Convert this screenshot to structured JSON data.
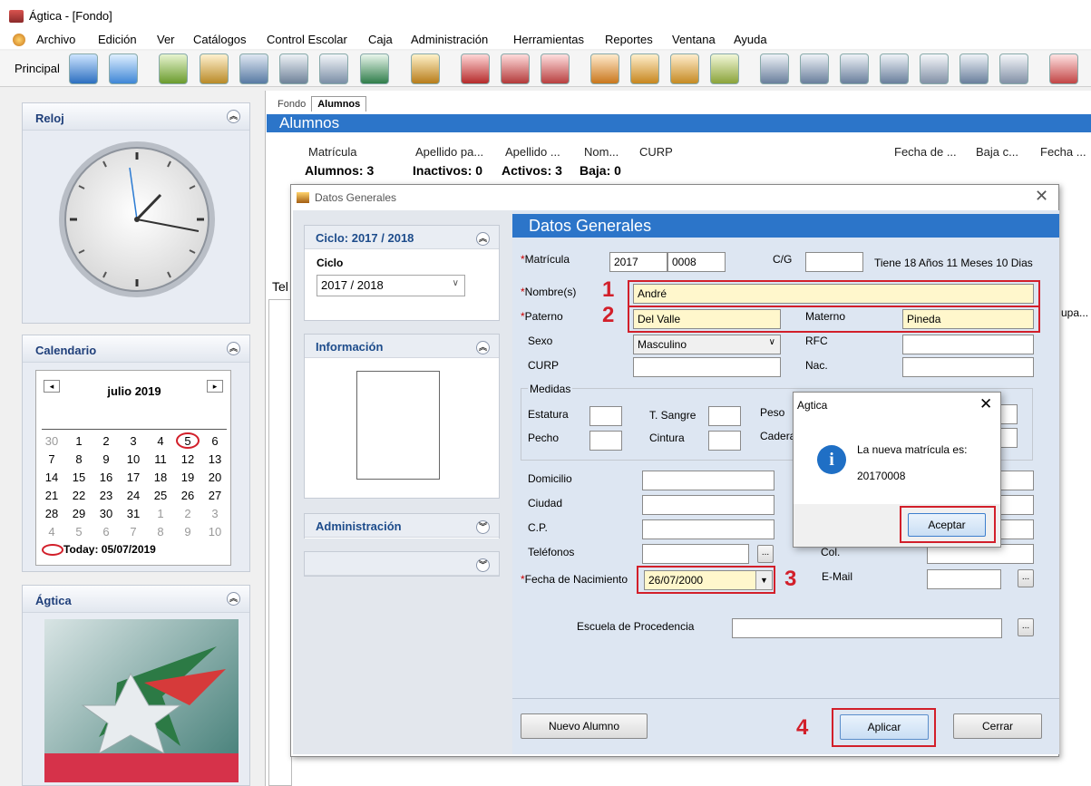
{
  "window": {
    "title": "Ágtica - [Fondo]"
  },
  "menu": [
    "Archivo",
    "Edición",
    "Ver",
    "Catálogos",
    "Control Escolar",
    "Caja",
    "Administración",
    "Herramientas",
    "Reportes",
    "Ventana",
    "Ayuda"
  ],
  "toolbar": {
    "label": "Principal"
  },
  "left": {
    "clock_title": "Reloj",
    "calendar_title": "Calendario",
    "month": "julio 2019",
    "weeks": [
      [
        "30",
        "1",
        "2",
        "3",
        "4",
        "5",
        "6"
      ],
      [
        "7",
        "8",
        "9",
        "10",
        "11",
        "12",
        "13"
      ],
      [
        "14",
        "15",
        "16",
        "17",
        "18",
        "19",
        "20"
      ],
      [
        "21",
        "22",
        "23",
        "24",
        "25",
        "26",
        "27"
      ],
      [
        "28",
        "29",
        "30",
        "31",
        "1",
        "2",
        "3"
      ],
      [
        "4",
        "5",
        "6",
        "7",
        "8",
        "9",
        "10"
      ]
    ],
    "today": "Today: 05/07/2019",
    "agtica_title": "Ágtica"
  },
  "main": {
    "tabs": [
      "Fondo",
      "Alumnos"
    ],
    "header": "Alumnos",
    "columns": [
      "Matrícula",
      "Apellido pa...",
      "Apellido ...",
      "Nom...",
      "CURP",
      "Fecha de ...",
      "Baja c...",
      "Fecha ..."
    ],
    "counts": [
      "Alumnos: 3",
      "Inactivos: 0",
      "Activos: 3",
      "Baja: 0"
    ],
    "tel": "Tel",
    "ocupa": "upa..."
  },
  "dialog": {
    "title": "Datos Generales",
    "ciclo_header": "Ciclo: 2017 / 2018",
    "ciclo_label": "Ciclo",
    "ciclo_value": "2017 / 2018",
    "info_header": "Información",
    "admin_header": "Administración",
    "heading": "Datos Generales",
    "matricula_label": "Matrícula",
    "matricula_1": "2017",
    "matricula_2": "0008",
    "cg_label": "C/G",
    "age": "Tiene 18 Años 11 Meses 10 Dias",
    "nombre_label": "Nombre(s)",
    "nombre": "André",
    "paterno_label": "Paterno",
    "paterno": "Del Valle",
    "materno_label": "Materno",
    "materno": "Pineda",
    "sexo_label": "Sexo",
    "sexo": "Masculino",
    "rfc_label": "RFC",
    "curp_label": "CURP",
    "nac_label": "Nac.",
    "medidas_label": "Medidas",
    "estatura_label": "Estatura",
    "sangre_label": "T. Sangre",
    "peso_label": "Peso",
    "pecho_label": "Pecho",
    "cintura_label": "Cintura",
    "cadera_label": "Cadera",
    "domicilio_label": "Domicilio",
    "ciudad_label": "Ciudad",
    "cp_label": "C.P.",
    "telefonos_label": "Teléfonos",
    "col_label": "Col.",
    "fecha_label": "Fecha de Nacimiento",
    "fecha": "26/07/2000",
    "email_label": "E-Mail",
    "escuela_label": "Escuela de Procedencia",
    "nuevo": "Nuevo Alumno",
    "aplicar": "Aplicar",
    "cerrar": "Cerrar"
  },
  "message": {
    "title": "Agtica",
    "text": "La nueva matrícula es:",
    "value": "20170008",
    "ok": "Aceptar"
  },
  "markers": [
    "1",
    "2",
    "3",
    "4"
  ]
}
